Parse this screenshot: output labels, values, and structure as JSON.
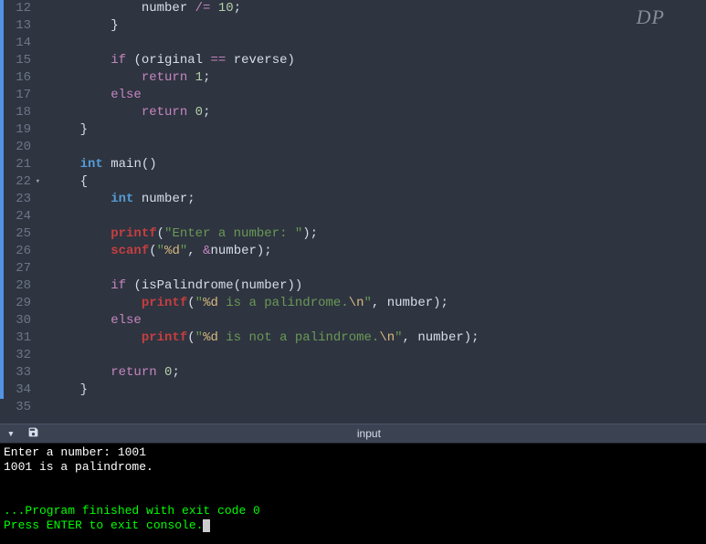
{
  "watermark": "DP",
  "toolbar": {
    "center_label": "input"
  },
  "code_lines": [
    {
      "num": 12,
      "modified": true,
      "tokens": [
        {
          "cls": "",
          "txt": "            "
        },
        {
          "cls": "tk-ident",
          "txt": "number"
        },
        {
          "cls": "",
          "txt": " "
        },
        {
          "cls": "tk-op",
          "txt": "/="
        },
        {
          "cls": "",
          "txt": " "
        },
        {
          "cls": "tk-number",
          "txt": "10"
        },
        {
          "cls": "tk-punct",
          "txt": ";"
        }
      ]
    },
    {
      "num": 13,
      "modified": true,
      "tokens": [
        {
          "cls": "",
          "txt": "        "
        },
        {
          "cls": "tk-punct",
          "txt": "}"
        }
      ]
    },
    {
      "num": 14,
      "modified": true,
      "tokens": []
    },
    {
      "num": 15,
      "modified": true,
      "tokens": [
        {
          "cls": "",
          "txt": "        "
        },
        {
          "cls": "tk-keyword",
          "txt": "if"
        },
        {
          "cls": "",
          "txt": " "
        },
        {
          "cls": "tk-punct",
          "txt": "("
        },
        {
          "cls": "tk-ident",
          "txt": "original"
        },
        {
          "cls": "",
          "txt": " "
        },
        {
          "cls": "tk-op",
          "txt": "=="
        },
        {
          "cls": "",
          "txt": " "
        },
        {
          "cls": "tk-ident",
          "txt": "reverse"
        },
        {
          "cls": "tk-punct",
          "txt": ")"
        }
      ]
    },
    {
      "num": 16,
      "modified": true,
      "tokens": [
        {
          "cls": "",
          "txt": "            "
        },
        {
          "cls": "tk-keyword",
          "txt": "return"
        },
        {
          "cls": "",
          "txt": " "
        },
        {
          "cls": "tk-number",
          "txt": "1"
        },
        {
          "cls": "tk-punct",
          "txt": ";"
        }
      ]
    },
    {
      "num": 17,
      "modified": true,
      "tokens": [
        {
          "cls": "",
          "txt": "        "
        },
        {
          "cls": "tk-keyword",
          "txt": "else"
        }
      ]
    },
    {
      "num": 18,
      "modified": true,
      "tokens": [
        {
          "cls": "",
          "txt": "            "
        },
        {
          "cls": "tk-keyword",
          "txt": "return"
        },
        {
          "cls": "",
          "txt": " "
        },
        {
          "cls": "tk-number",
          "txt": "0"
        },
        {
          "cls": "tk-punct",
          "txt": ";"
        }
      ]
    },
    {
      "num": 19,
      "modified": true,
      "tokens": [
        {
          "cls": "",
          "txt": "    "
        },
        {
          "cls": "tk-punct",
          "txt": "}"
        }
      ]
    },
    {
      "num": 20,
      "modified": true,
      "tokens": []
    },
    {
      "num": 21,
      "modified": true,
      "tokens": [
        {
          "cls": "",
          "txt": "    "
        },
        {
          "cls": "tk-type",
          "txt": "int"
        },
        {
          "cls": "",
          "txt": " "
        },
        {
          "cls": "tk-ident",
          "txt": "main"
        },
        {
          "cls": "tk-punct",
          "txt": "()"
        }
      ]
    },
    {
      "num": 22,
      "modified": true,
      "fold": true,
      "tokens": [
        {
          "cls": "",
          "txt": "    "
        },
        {
          "cls": "tk-punct",
          "txt": "{"
        }
      ]
    },
    {
      "num": 23,
      "modified": true,
      "tokens": [
        {
          "cls": "",
          "txt": "        "
        },
        {
          "cls": "tk-type",
          "txt": "int"
        },
        {
          "cls": "",
          "txt": " "
        },
        {
          "cls": "tk-ident",
          "txt": "number"
        },
        {
          "cls": "tk-punct",
          "txt": ";"
        }
      ]
    },
    {
      "num": 24,
      "modified": true,
      "tokens": []
    },
    {
      "num": 25,
      "modified": true,
      "tokens": [
        {
          "cls": "",
          "txt": "        "
        },
        {
          "cls": "tk-func",
          "txt": "printf"
        },
        {
          "cls": "tk-punct",
          "txt": "("
        },
        {
          "cls": "tk-string",
          "txt": "\"Enter a number: \""
        },
        {
          "cls": "tk-punct",
          "txt": ");"
        }
      ]
    },
    {
      "num": 26,
      "modified": true,
      "tokens": [
        {
          "cls": "",
          "txt": "        "
        },
        {
          "cls": "tk-func",
          "txt": "scanf"
        },
        {
          "cls": "tk-punct",
          "txt": "("
        },
        {
          "cls": "tk-string",
          "txt": "\""
        },
        {
          "cls": "tk-escape",
          "txt": "%d"
        },
        {
          "cls": "tk-string",
          "txt": "\""
        },
        {
          "cls": "tk-punct",
          "txt": ", "
        },
        {
          "cls": "tk-op",
          "txt": "&"
        },
        {
          "cls": "tk-ident",
          "txt": "number"
        },
        {
          "cls": "tk-punct",
          "txt": ");"
        }
      ]
    },
    {
      "num": 27,
      "modified": true,
      "tokens": []
    },
    {
      "num": 28,
      "modified": true,
      "tokens": [
        {
          "cls": "",
          "txt": "        "
        },
        {
          "cls": "tk-keyword",
          "txt": "if"
        },
        {
          "cls": "",
          "txt": " "
        },
        {
          "cls": "tk-punct",
          "txt": "("
        },
        {
          "cls": "tk-ident",
          "txt": "isPalindrome"
        },
        {
          "cls": "tk-punct",
          "txt": "("
        },
        {
          "cls": "tk-ident",
          "txt": "number"
        },
        {
          "cls": "tk-punct",
          "txt": "))"
        }
      ]
    },
    {
      "num": 29,
      "modified": true,
      "tokens": [
        {
          "cls": "",
          "txt": "            "
        },
        {
          "cls": "tk-func",
          "txt": "printf"
        },
        {
          "cls": "tk-punct",
          "txt": "("
        },
        {
          "cls": "tk-string",
          "txt": "\""
        },
        {
          "cls": "tk-escape",
          "txt": "%d"
        },
        {
          "cls": "tk-string",
          "txt": " is a palindrome."
        },
        {
          "cls": "tk-escape",
          "txt": "\\n"
        },
        {
          "cls": "tk-string",
          "txt": "\""
        },
        {
          "cls": "tk-punct",
          "txt": ", "
        },
        {
          "cls": "tk-ident",
          "txt": "number"
        },
        {
          "cls": "tk-punct",
          "txt": ");"
        }
      ]
    },
    {
      "num": 30,
      "modified": true,
      "tokens": [
        {
          "cls": "",
          "txt": "        "
        },
        {
          "cls": "tk-keyword",
          "txt": "else"
        }
      ]
    },
    {
      "num": 31,
      "modified": true,
      "tokens": [
        {
          "cls": "",
          "txt": "            "
        },
        {
          "cls": "tk-func",
          "txt": "printf"
        },
        {
          "cls": "tk-punct",
          "txt": "("
        },
        {
          "cls": "tk-string",
          "txt": "\""
        },
        {
          "cls": "tk-escape",
          "txt": "%d"
        },
        {
          "cls": "tk-string",
          "txt": " is not a palindrome."
        },
        {
          "cls": "tk-escape",
          "txt": "\\n"
        },
        {
          "cls": "tk-string",
          "txt": "\""
        },
        {
          "cls": "tk-punct",
          "txt": ", "
        },
        {
          "cls": "tk-ident",
          "txt": "number"
        },
        {
          "cls": "tk-punct",
          "txt": ");"
        }
      ]
    },
    {
      "num": 32,
      "modified": true,
      "tokens": []
    },
    {
      "num": 33,
      "modified": true,
      "tokens": [
        {
          "cls": "",
          "txt": "        "
        },
        {
          "cls": "tk-keyword",
          "txt": "return"
        },
        {
          "cls": "",
          "txt": " "
        },
        {
          "cls": "tk-number",
          "txt": "0"
        },
        {
          "cls": "tk-punct",
          "txt": ";"
        }
      ]
    },
    {
      "num": 34,
      "modified": true,
      "tokens": [
        {
          "cls": "",
          "txt": "    "
        },
        {
          "cls": "tk-punct",
          "txt": "}"
        }
      ]
    },
    {
      "num": 35,
      "modified": false,
      "tokens": []
    }
  ],
  "console": {
    "line1": "Enter a number: 1001",
    "line2": "1001 is a palindrome.",
    "blank": "",
    "exit_msg": "...Program finished with exit code 0",
    "prompt": "Press ENTER to exit console."
  }
}
